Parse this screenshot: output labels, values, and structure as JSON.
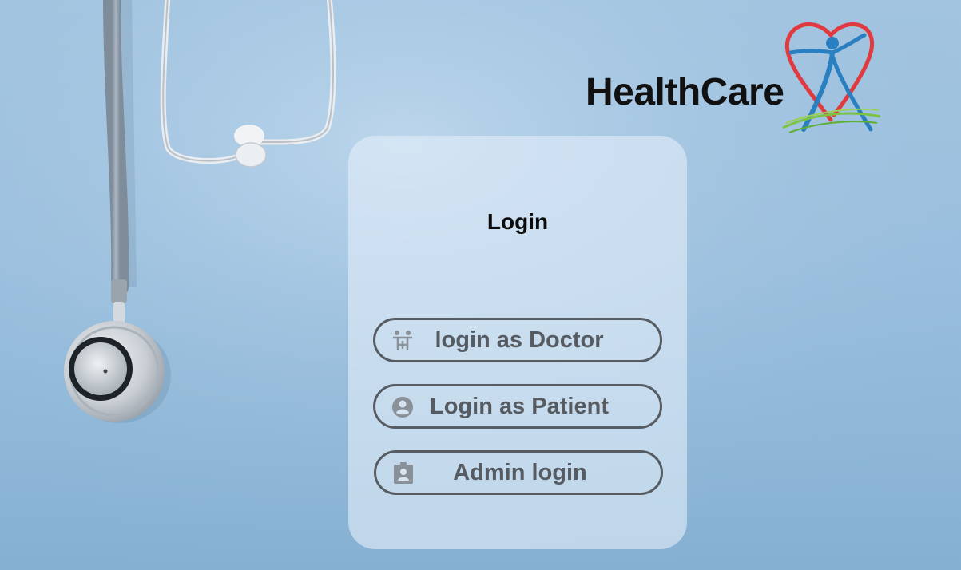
{
  "brand": {
    "name": "HealthCare",
    "logo_icon": "heart-person-logo",
    "colors": {
      "heart": "#e0393e",
      "person": "#2a7fc1",
      "grass": "#7cc243"
    }
  },
  "login": {
    "title": "Login",
    "buttons": [
      {
        "label": "login as Doctor",
        "icon": "doctor-icon"
      },
      {
        "label": "Login as Patient",
        "icon": "patient-icon"
      },
      {
        "label": "Admin login",
        "icon": "admin-badge-icon"
      }
    ]
  },
  "colors": {
    "background": "#9cc0df",
    "card": "#e2eef8",
    "button_border": "#575c63",
    "button_text": "#565b62"
  }
}
